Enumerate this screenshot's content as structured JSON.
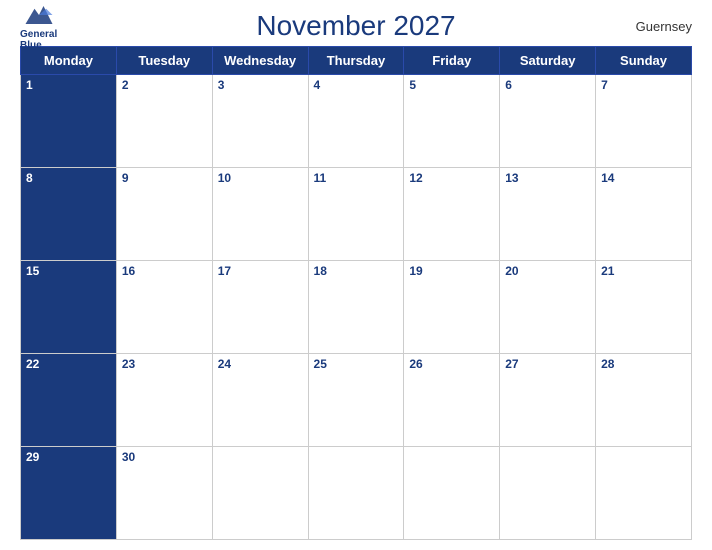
{
  "header": {
    "title": "November 2027",
    "region": "Guernsey",
    "logo_line1": "General",
    "logo_line2": "Blue"
  },
  "days_of_week": [
    "Monday",
    "Tuesday",
    "Wednesday",
    "Thursday",
    "Friday",
    "Saturday",
    "Sunday"
  ],
  "weeks": [
    [
      {
        "num": "1",
        "header": true
      },
      {
        "num": "2",
        "header": false
      },
      {
        "num": "3",
        "header": false
      },
      {
        "num": "4",
        "header": false
      },
      {
        "num": "5",
        "header": false
      },
      {
        "num": "6",
        "header": false
      },
      {
        "num": "7",
        "header": false
      }
    ],
    [
      {
        "num": "8",
        "header": true
      },
      {
        "num": "9",
        "header": false
      },
      {
        "num": "10",
        "header": false
      },
      {
        "num": "11",
        "header": false
      },
      {
        "num": "12",
        "header": false
      },
      {
        "num": "13",
        "header": false
      },
      {
        "num": "14",
        "header": false
      }
    ],
    [
      {
        "num": "15",
        "header": true
      },
      {
        "num": "16",
        "header": false
      },
      {
        "num": "17",
        "header": false
      },
      {
        "num": "18",
        "header": false
      },
      {
        "num": "19",
        "header": false
      },
      {
        "num": "20",
        "header": false
      },
      {
        "num": "21",
        "header": false
      }
    ],
    [
      {
        "num": "22",
        "header": true
      },
      {
        "num": "23",
        "header": false
      },
      {
        "num": "24",
        "header": false
      },
      {
        "num": "25",
        "header": false
      },
      {
        "num": "26",
        "header": false
      },
      {
        "num": "27",
        "header": false
      },
      {
        "num": "28",
        "header": false
      }
    ],
    [
      {
        "num": "29",
        "header": true
      },
      {
        "num": "30",
        "header": false
      },
      {
        "num": "",
        "header": false
      },
      {
        "num": "",
        "header": false
      },
      {
        "num": "",
        "header": false
      },
      {
        "num": "",
        "header": false
      },
      {
        "num": "",
        "header": false
      }
    ]
  ]
}
